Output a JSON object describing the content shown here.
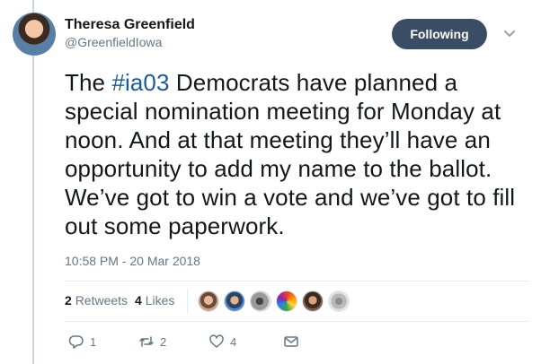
{
  "author": {
    "display_name": "Theresa Greenfield",
    "screen_name": "@GreenfieldIowa"
  },
  "follow_button": {
    "label": "Following"
  },
  "tweet": {
    "text_before": "The ",
    "hashtag": "#ia03",
    "text_after": " Democrats have planned a special nomination meeting for Monday at noon. And at that meeting they’ll have an opportunity to add my name to the ballot. We’ve got to win a vote and we’ve got to fill out some paperwork.",
    "timestamp": "10:58 PM - 20 Mar 2018"
  },
  "stats": {
    "retweets_count": "2",
    "retweets_label": "Retweets",
    "likes_count": "4",
    "likes_label": "Likes"
  },
  "actions": {
    "reply_count": "1",
    "retweet_count": "2",
    "like_count": "4"
  },
  "icons": {
    "reply": "reply-icon",
    "retweet": "retweet-icon",
    "like": "heart-icon",
    "dm": "envelope-icon",
    "caret": "chevron-down-icon"
  },
  "colors": {
    "follow_button_bg": "#3b4c65",
    "hashtag": "#1b5a93",
    "muted": "#657786"
  }
}
